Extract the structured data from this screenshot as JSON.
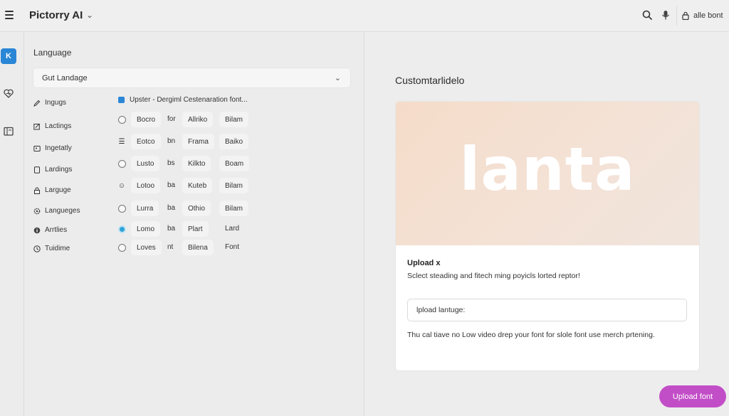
{
  "header": {
    "app_title": "Pictorry AI",
    "account_label": "alle bont"
  },
  "rail": {
    "active_label": "K"
  },
  "left_panel": {
    "section_label": "Language",
    "language_select": {
      "selected": "Gut Landage"
    },
    "side_items": [
      {
        "label": "Ingugs",
        "icon": "pencil-icon"
      },
      {
        "label": "Lactings",
        "icon": "edit-box-icon"
      },
      {
        "label": "Ingetatly",
        "icon": "image-icon"
      },
      {
        "label": "Lardings",
        "icon": "page-icon"
      },
      {
        "label": "Larguge",
        "icon": "lock-icon"
      },
      {
        "label": "Langueges",
        "icon": "settings-icon"
      },
      {
        "label": "Arrtlies",
        "icon": "info-icon"
      },
      {
        "label": "Tuidime",
        "icon": "clock-icon"
      }
    ],
    "options_header": "Upster - Dergiml Cestenaration font...",
    "option_rows": [
      {
        "marker": "radio",
        "c1": "Bocro",
        "c2": "for",
        "c3": "Allriko",
        "c4": "Bilam"
      },
      {
        "marker": "list",
        "c1": "Eotco",
        "c2": "bn",
        "c3": "Frama",
        "c4": "Baiko"
      },
      {
        "marker": "radio",
        "c1": "Lusto",
        "c2": "bs",
        "c3": "Kilkto",
        "c4": "Boam"
      },
      {
        "marker": "face",
        "c1": "Lotoo",
        "c2": "ba",
        "c3": "Kuteb",
        "c4": "Bilam"
      },
      {
        "marker": "radio",
        "c1": "Lurra",
        "c2": "ba",
        "c3": "Othio",
        "c4": "Bilam"
      },
      {
        "marker": "checked",
        "c1": "Lomo",
        "c2": "ba",
        "c3": "Plart",
        "c4": "Lard"
      },
      {
        "marker": "radio",
        "c1": "Loves",
        "c2": "nt",
        "c3": "Bilena",
        "c4": "Font"
      }
    ]
  },
  "right_panel": {
    "title": "Customtarlidelo",
    "preview_word": "lanta",
    "card_heading": "Upload x",
    "card_description": "Sclect steading and fitech ming poyicls lorted reptor!",
    "upload_input_value": "lpload lantuge:",
    "card_note": "Thu cal tiave no Low video drep your font for slole font use merch prtening.",
    "upload_button_label": "Upload font"
  },
  "colors": {
    "accent_blue": "#2a86d6",
    "upload_button": "#c24ec7",
    "preview_bg": "#f5dcc9"
  }
}
